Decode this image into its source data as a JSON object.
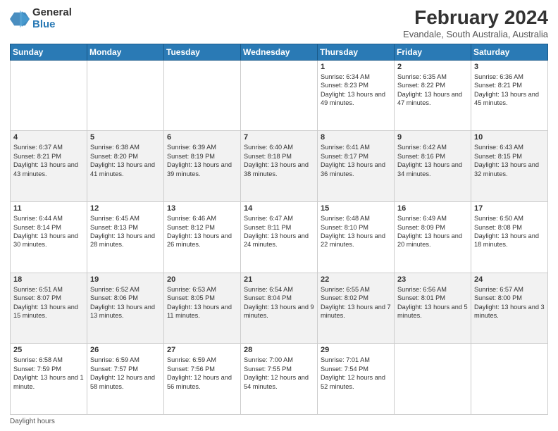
{
  "logo": {
    "general": "General",
    "blue": "Blue"
  },
  "header": {
    "title": "February 2024",
    "subtitle": "Evandale, South Australia, Australia"
  },
  "days_of_week": [
    "Sunday",
    "Monday",
    "Tuesday",
    "Wednesday",
    "Thursday",
    "Friday",
    "Saturday"
  ],
  "weeks": [
    [
      {
        "day": "",
        "info": ""
      },
      {
        "day": "",
        "info": ""
      },
      {
        "day": "",
        "info": ""
      },
      {
        "day": "",
        "info": ""
      },
      {
        "day": "1",
        "info": "Sunrise: 6:34 AM\nSunset: 8:23 PM\nDaylight: 13 hours and 49 minutes."
      },
      {
        "day": "2",
        "info": "Sunrise: 6:35 AM\nSunset: 8:22 PM\nDaylight: 13 hours and 47 minutes."
      },
      {
        "day": "3",
        "info": "Sunrise: 6:36 AM\nSunset: 8:21 PM\nDaylight: 13 hours and 45 minutes."
      }
    ],
    [
      {
        "day": "4",
        "info": "Sunrise: 6:37 AM\nSunset: 8:21 PM\nDaylight: 13 hours and 43 minutes."
      },
      {
        "day": "5",
        "info": "Sunrise: 6:38 AM\nSunset: 8:20 PM\nDaylight: 13 hours and 41 minutes."
      },
      {
        "day": "6",
        "info": "Sunrise: 6:39 AM\nSunset: 8:19 PM\nDaylight: 13 hours and 39 minutes."
      },
      {
        "day": "7",
        "info": "Sunrise: 6:40 AM\nSunset: 8:18 PM\nDaylight: 13 hours and 38 minutes."
      },
      {
        "day": "8",
        "info": "Sunrise: 6:41 AM\nSunset: 8:17 PM\nDaylight: 13 hours and 36 minutes."
      },
      {
        "day": "9",
        "info": "Sunrise: 6:42 AM\nSunset: 8:16 PM\nDaylight: 13 hours and 34 minutes."
      },
      {
        "day": "10",
        "info": "Sunrise: 6:43 AM\nSunset: 8:15 PM\nDaylight: 13 hours and 32 minutes."
      }
    ],
    [
      {
        "day": "11",
        "info": "Sunrise: 6:44 AM\nSunset: 8:14 PM\nDaylight: 13 hours and 30 minutes."
      },
      {
        "day": "12",
        "info": "Sunrise: 6:45 AM\nSunset: 8:13 PM\nDaylight: 13 hours and 28 minutes."
      },
      {
        "day": "13",
        "info": "Sunrise: 6:46 AM\nSunset: 8:12 PM\nDaylight: 13 hours and 26 minutes."
      },
      {
        "day": "14",
        "info": "Sunrise: 6:47 AM\nSunset: 8:11 PM\nDaylight: 13 hours and 24 minutes."
      },
      {
        "day": "15",
        "info": "Sunrise: 6:48 AM\nSunset: 8:10 PM\nDaylight: 13 hours and 22 minutes."
      },
      {
        "day": "16",
        "info": "Sunrise: 6:49 AM\nSunset: 8:09 PM\nDaylight: 13 hours and 20 minutes."
      },
      {
        "day": "17",
        "info": "Sunrise: 6:50 AM\nSunset: 8:08 PM\nDaylight: 13 hours and 18 minutes."
      }
    ],
    [
      {
        "day": "18",
        "info": "Sunrise: 6:51 AM\nSunset: 8:07 PM\nDaylight: 13 hours and 15 minutes."
      },
      {
        "day": "19",
        "info": "Sunrise: 6:52 AM\nSunset: 8:06 PM\nDaylight: 13 hours and 13 minutes."
      },
      {
        "day": "20",
        "info": "Sunrise: 6:53 AM\nSunset: 8:05 PM\nDaylight: 13 hours and 11 minutes."
      },
      {
        "day": "21",
        "info": "Sunrise: 6:54 AM\nSunset: 8:04 PM\nDaylight: 13 hours and 9 minutes."
      },
      {
        "day": "22",
        "info": "Sunrise: 6:55 AM\nSunset: 8:02 PM\nDaylight: 13 hours and 7 minutes."
      },
      {
        "day": "23",
        "info": "Sunrise: 6:56 AM\nSunset: 8:01 PM\nDaylight: 13 hours and 5 minutes."
      },
      {
        "day": "24",
        "info": "Sunrise: 6:57 AM\nSunset: 8:00 PM\nDaylight: 13 hours and 3 minutes."
      }
    ],
    [
      {
        "day": "25",
        "info": "Sunrise: 6:58 AM\nSunset: 7:59 PM\nDaylight: 13 hours and 1 minute."
      },
      {
        "day": "26",
        "info": "Sunrise: 6:59 AM\nSunset: 7:57 PM\nDaylight: 12 hours and 58 minutes."
      },
      {
        "day": "27",
        "info": "Sunrise: 6:59 AM\nSunset: 7:56 PM\nDaylight: 12 hours and 56 minutes."
      },
      {
        "day": "28",
        "info": "Sunrise: 7:00 AM\nSunset: 7:55 PM\nDaylight: 12 hours and 54 minutes."
      },
      {
        "day": "29",
        "info": "Sunrise: 7:01 AM\nSunset: 7:54 PM\nDaylight: 12 hours and 52 minutes."
      },
      {
        "day": "",
        "info": ""
      },
      {
        "day": "",
        "info": ""
      }
    ]
  ],
  "footer": {
    "note": "Daylight hours"
  }
}
